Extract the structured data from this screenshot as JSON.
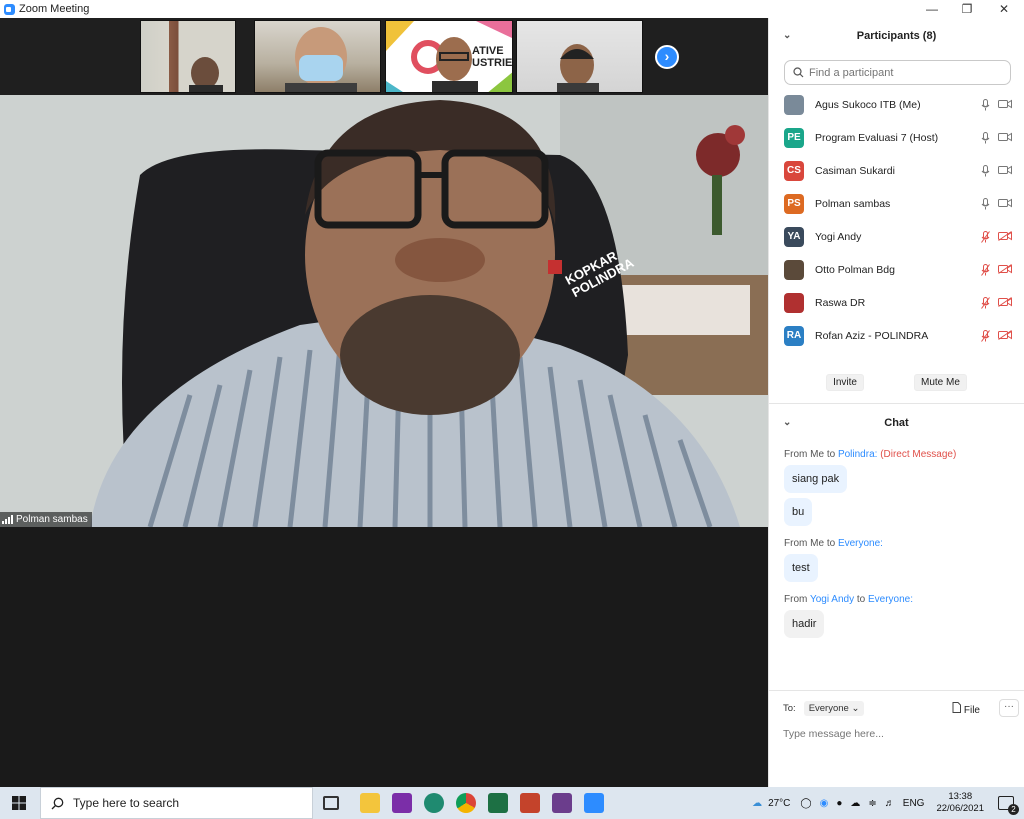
{
  "window": {
    "title": "Zoom Meeting"
  },
  "video": {
    "main_speaker": "Polman sambas",
    "shirt_logo_text": "KOPKAR POLINDRA",
    "banner_text": "ATIVE USTRIE"
  },
  "participants": {
    "header": "Participants (8)",
    "search_placeholder": "Find a participant",
    "list": [
      {
        "name": "Agus Sukoco ITB (Me)",
        "initials": "",
        "color": "#7a8a99",
        "mic": "on",
        "video": "on"
      },
      {
        "name": "Program Evaluasi 7 (Host)",
        "initials": "PE",
        "color": "#1aa68a",
        "mic": "on",
        "video": "on"
      },
      {
        "name": "Casiman Sukardi",
        "initials": "CS",
        "color": "#d9473c",
        "mic": "on",
        "video": "on"
      },
      {
        "name": "Polman sambas",
        "initials": "PS",
        "color": "#dd6a22",
        "mic": "on",
        "video": "on"
      },
      {
        "name": "Yogi Andy",
        "initials": "YA",
        "color": "#3a4a5c",
        "mic": "off",
        "video": "off"
      },
      {
        "name": "Otto Polman Bdg",
        "initials": "",
        "color": "#5b4a3a",
        "mic": "off",
        "video": "off"
      },
      {
        "name": "Raswa DR",
        "initials": "",
        "color": "#b03030",
        "mic": "off",
        "video": "off"
      },
      {
        "name": "Rofan Aziz - POLINDRA",
        "initials": "RA",
        "color": "#2b7fc4",
        "mic": "off",
        "video": "off"
      }
    ],
    "invite_label": "Invite",
    "mute_label": "Mute Me"
  },
  "chat": {
    "header": "Chat",
    "messages": [
      {
        "from": "Me",
        "to": "Polindra:",
        "tag": "(Direct Message)",
        "bubbles": [
          "siang pak",
          "bu"
        ]
      },
      {
        "from": "Me",
        "to": "Everyone:",
        "tag": "",
        "bubbles": [
          "test"
        ]
      },
      {
        "from": "Yogi Andy",
        "to": "Everyone:",
        "tag": "",
        "bubbles": [
          "hadir"
        ]
      }
    ],
    "from_word": "From",
    "to_word": "to",
    "to_label": "To:",
    "to_value": "Everyone",
    "file_label": "File",
    "more_label": "···",
    "input_placeholder": "Type message here..."
  },
  "taskbar": {
    "search_placeholder": "Type here to search",
    "weather": "27°C",
    "lang": "ENG",
    "time": "13:38",
    "date": "22/06/2021",
    "notif_count": "2"
  }
}
